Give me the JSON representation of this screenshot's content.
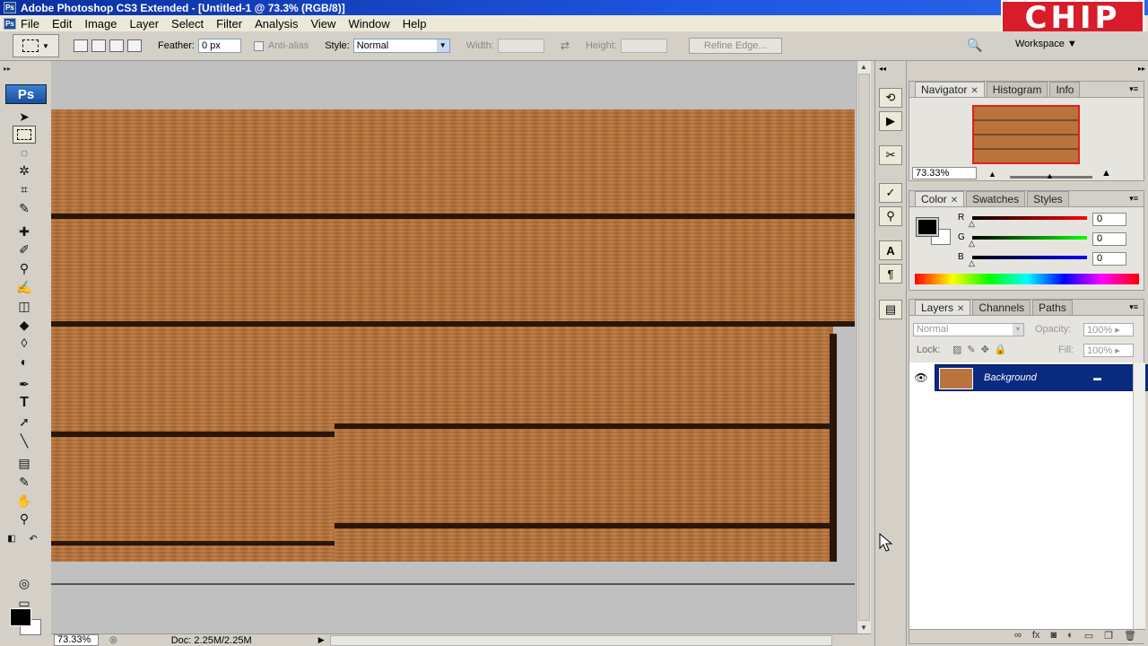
{
  "window": {
    "title": "Adobe Photoshop CS3 Extended - [Untitled-1 @ 73.3% (RGB/8)]",
    "app_icon": "ps-icon"
  },
  "watermark": {
    "text": "CHIP"
  },
  "menu": [
    "File",
    "Edit",
    "Image",
    "Layer",
    "Select",
    "Filter",
    "Analysis",
    "View",
    "Window",
    "Help"
  ],
  "options": {
    "feather_label": "Feather:",
    "feather_value": "0 px",
    "antialias_label": "Anti-alias",
    "style_label": "Style:",
    "style_value": "Normal",
    "width_label": "Width:",
    "height_label": "Height:",
    "refine_label": "Refine Edge...",
    "workspace_label": "Workspace"
  },
  "toolbox": {
    "logo": "Ps",
    "tools": [
      "move-tool-icon",
      "marquee-tool-icon",
      "lasso-tool-icon",
      "magic-wand-icon",
      "crop-tool-icon",
      "slice-tool-icon",
      "healing-brush-icon",
      "brush-tool-icon",
      "clone-stamp-icon",
      "history-brush-icon",
      "eraser-tool-icon",
      "paint-bucket-icon",
      "blur-tool-icon",
      "dodge-tool-icon",
      "pen-tool-icon",
      "type-tool-icon",
      "path-selection-icon",
      "line-tool-icon",
      "notes-tool-icon",
      "eyedropper-icon",
      "hand-tool-icon",
      "zoom-tool-icon",
      "quick-mask-icon",
      "screen-mode-icon"
    ],
    "foreground_color": "#000000",
    "background_color": "#ffffff"
  },
  "canvas": {
    "wood_color": "#b8743c",
    "seam_color": "#2a160a"
  },
  "status": {
    "zoom": "73.33%",
    "doc": "Doc: 2.25M/2.25M"
  },
  "panels": {
    "navigator": {
      "tabs": [
        "Navigator",
        "Histogram",
        "Info"
      ],
      "zoom": "73.33%"
    },
    "color": {
      "tabs": [
        "Color",
        "Swatches",
        "Styles"
      ],
      "channels": [
        {
          "label": "R",
          "value": "0"
        },
        {
          "label": "G",
          "value": "0"
        },
        {
          "label": "B",
          "value": "0"
        }
      ]
    },
    "layers": {
      "tabs": [
        "Layers",
        "Channels",
        "Paths"
      ],
      "blend_mode": "Normal",
      "opacity_label": "Opacity:",
      "opacity": "100%",
      "lock_label": "Lock:",
      "fill_label": "Fill:",
      "fill": "100%",
      "items": [
        {
          "name": "Background",
          "visible": true,
          "locked": true
        }
      ]
    }
  }
}
